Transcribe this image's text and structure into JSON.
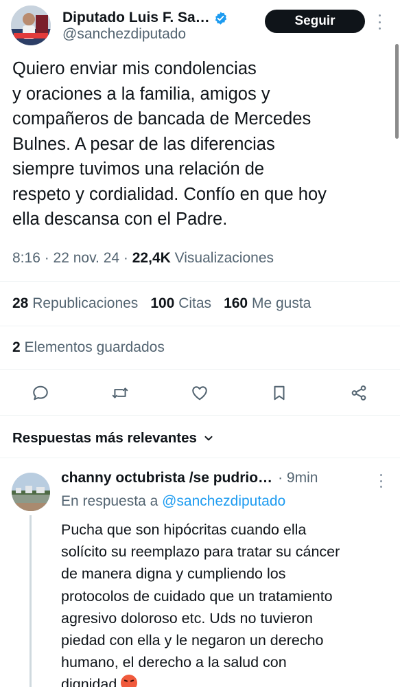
{
  "author": {
    "name": "Diputado Luis F. Sa…",
    "handle": "@sanchezdiputado",
    "verified_color": "#1d9bf0",
    "follow_label": "Seguir"
  },
  "tweet": {
    "text": "Quiero enviar mis condolencias\ny oraciones a la familia, amigos y\ncompañeros de bancada de Mercedes\nBulnes. A pesar de las diferencias\nsiempre tuvimos una relación de\nrespeto y cordialidad. Confío en que hoy\nella descansa con el Padre.",
    "time": "8:16",
    "date": "22 nov. 24",
    "views_count": "22,4K",
    "views_label": "Visualizaciones"
  },
  "stats": {
    "reposts_count": "28",
    "reposts_label": "Republicaciones",
    "quotes_count": "100",
    "quotes_label": "Citas",
    "likes_count": "160",
    "likes_label": "Me gusta",
    "bookmarks_count": "2",
    "bookmarks_label": "Elementos guardados"
  },
  "actions": [
    "reply-icon",
    "repost-icon",
    "like-icon",
    "bookmark-icon",
    "share-icon"
  ],
  "replies_sort": {
    "label": "Respuestas más relevantes"
  },
  "reply": {
    "name": "channy octubrista /se pudrio…",
    "time": "· 9min",
    "in_reply_prefix": "En respuesta a",
    "in_reply_handle": "@sanchezdiputado",
    "text": "Pucha que son hipócritas cuando ella\nsolícito su reemplazo para tratar su cáncer\nde manera digna y cumpliendo los\nprotocolos de cuidado que un tratamiento\nagresivo doloroso etc.  Uds no tuvieron\npiedad con ella y le negaron un derecho\nhumano, el derecho a la salud con\ndignidad",
    "emoji": "angry-face-emoji"
  },
  "colors": {
    "text": "#0f1419",
    "secondary": "#536471",
    "link": "#1d9bf0",
    "divider": "#eff3f4"
  }
}
